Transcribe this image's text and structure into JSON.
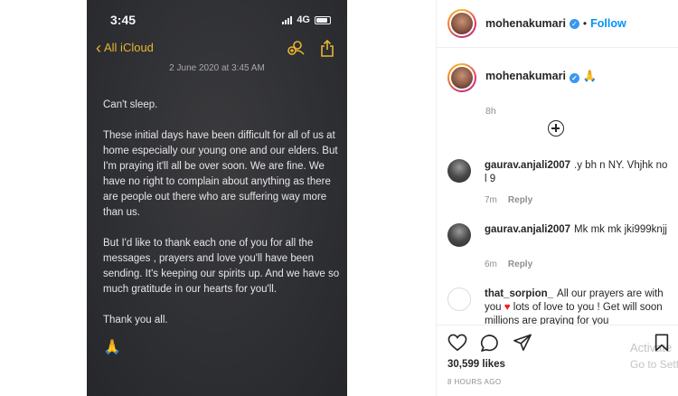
{
  "image": {
    "status_time": "3:45",
    "network": "4G",
    "back_label": "All iCloud",
    "date": "2 June 2020 at 3:45 AM",
    "paragraphs": [
      "Can't sleep.",
      "These initial days have been difficult for all of us at home especially our young one and our elders. But I'm praying it'll all be over soon. We are fine. We have no right to complain about anything as there are people out there who are suffering way more than us.",
      "But I'd like to thank each one of you for all the messages , prayers and love you'll have been sending. It's keeping our spirits up. And we have so much gratitude in our hearts for you'll.",
      "Thank you all."
    ],
    "emoji": "🙏"
  },
  "header": {
    "username": "mohenakumari",
    "separator": "•",
    "follow_label": "Follow"
  },
  "caption": {
    "username": "mohenakumari",
    "emoji": "🙏",
    "time": "8h"
  },
  "comments": [
    {
      "username": "gaurav.anjali2007",
      "text": ".y bh n NY. Vhjhk no l 9",
      "time": "7m",
      "reply": "Reply"
    },
    {
      "username": "gaurav.anjali2007",
      "text": "Mk mk mk jki999knjj",
      "time": "6m",
      "reply": "Reply"
    },
    {
      "username": "that_sorpion_",
      "text_a": "All our prayers are with you",
      "heart": "♥",
      "text_b": "lots of love to you ! Get will soon",
      "text_c": "millions are praying for you"
    }
  ],
  "footer": {
    "likes": "30,599 likes",
    "time_ago": "8 HOURS AGO",
    "watermark_line1": "Activate",
    "watermark_line2": "Go to Sett"
  },
  "icons": {
    "verified": "verified-badge-icon",
    "heart": "heart-icon",
    "comment": "comment-icon",
    "share": "share-icon",
    "bookmark": "bookmark-icon"
  },
  "colors": {
    "follow": "#0095f6",
    "verified": "#3897f0",
    "ios_accent": "#e8b530"
  }
}
